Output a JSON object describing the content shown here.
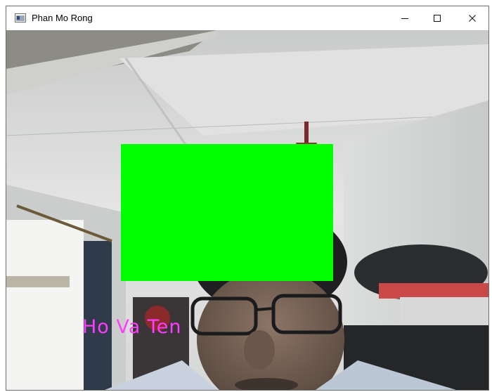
{
  "window": {
    "title": "Phan Mo Rong",
    "controls": {
      "minimize_icon": "minimize-icon",
      "maximize_icon": "maximize-icon",
      "close_icon": "close-icon"
    }
  },
  "camera": {
    "overlay_label": "Ho Va Ten",
    "overlay_label_color": "#ff3bff",
    "face_box_color": "#00ff00"
  }
}
